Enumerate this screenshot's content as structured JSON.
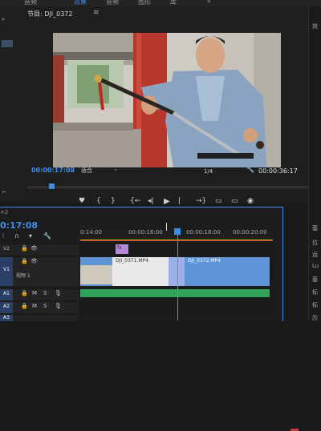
{
  "top_tabs": [
    {
      "label": "音频",
      "active": false
    },
    {
      "label": "效果",
      "active": true
    },
    {
      "label": "音频",
      "active": false
    },
    {
      "label": "图形",
      "active": false
    },
    {
      "label": "库",
      "active": false
    },
    {
      "label": "»",
      "active": false
    }
  ],
  "program_monitor": {
    "title": "节目: DJI_0372",
    "menu_glyph": "≡",
    "current_timecode": "00:00:17:08",
    "fit_label": "适合",
    "fit_caret": "⌄",
    "resolution": "1/4",
    "duration": "00:00:36:17",
    "wrench_glyph": "🔧",
    "transport": {
      "marker": "♥",
      "in": "{",
      "out": "}",
      "go_in": "{←",
      "step_back": "◂|",
      "play": "▶",
      "step_fwd": "|▸",
      "go_out": "→}",
      "lift": "▭",
      "extract": "▭",
      "export_frame": "◉",
      "add": "+"
    }
  },
  "timeline": {
    "tab": "×2",
    "timecode": "0:17:08",
    "ruler_ticks": [
      "0:14:00",
      "00:00:16:00",
      "00:00:18:00",
      "00:00:20:00"
    ],
    "tracks": [
      {
        "name": "V2",
        "label": ""
      },
      {
        "name": "V1",
        "label": "视频 1"
      },
      {
        "name": "A1",
        "label": ""
      },
      {
        "name": "A2",
        "label": ""
      },
      {
        "name": "A3",
        "label": ""
      }
    ],
    "track_controls": {
      "lock": "🔒",
      "eye": "👁",
      "mute": "M",
      "solo": "S",
      "mic": "🎙"
    },
    "clips": {
      "v2_fx": "fx",
      "v1_a": "DJI_0371.MP4",
      "v1_b": "DJI_0372.MP4",
      "v1_c": "fx"
    }
  },
  "right_panel": {
    "labels": [
      "效",
      "基",
      "位",
      "运",
      "Lu",
      "基",
      "标",
      "标",
      "历"
    ]
  },
  "colors": {
    "accent": "#3d8ee8",
    "clip_video": "#5f95d6",
    "clip_fx": "#b689d8",
    "audio": "#2fa35a",
    "marker_red": "#c23a3a"
  }
}
